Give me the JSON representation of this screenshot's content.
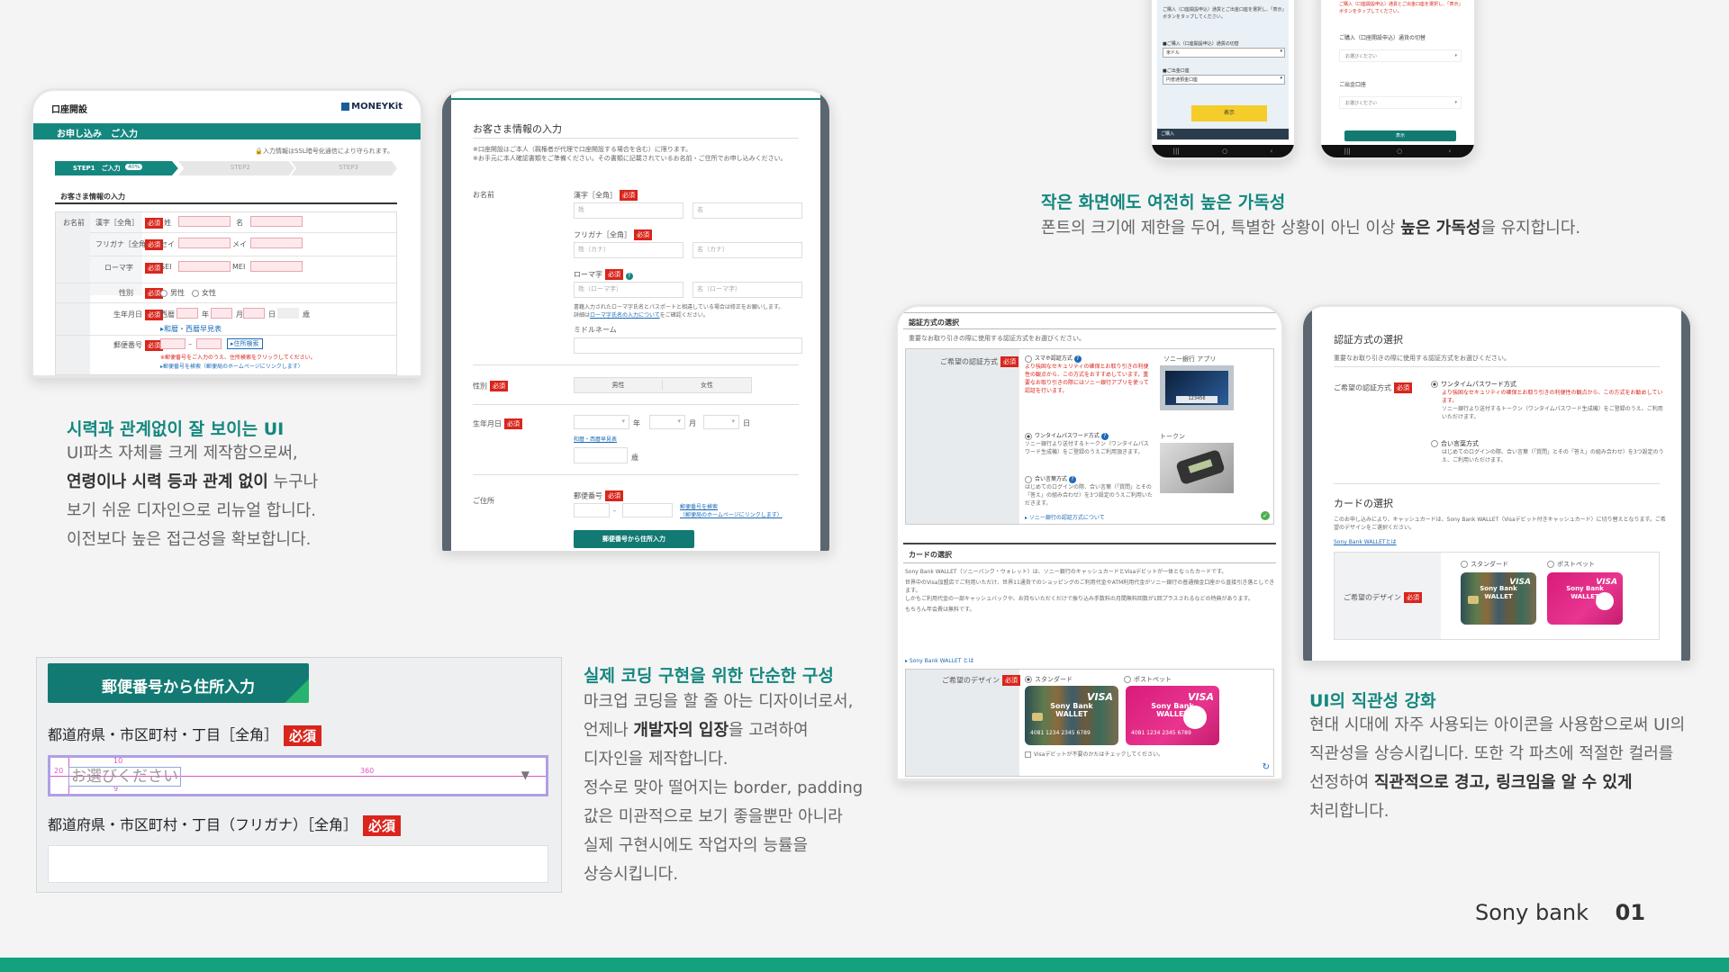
{
  "form_shot": {
    "title": "口座開設",
    "logo": "MONEYKit",
    "banner": "お申し込み　ご入力",
    "ssl_note": "入力情報はSSL暗号化通信により守られます。",
    "steps": [
      "STEP1　ご入力",
      "STEP2",
      "STEP3"
    ],
    "step1_badge": "40%",
    "section": "お客さま情報の入力",
    "name_label": "お名前",
    "kanji_label": "漢字［全角］",
    "kana_label": "フリガナ［全角］",
    "roma_label": "ローマ字",
    "sei": "姓",
    "mei": "名",
    "sei_kana": "セイ",
    "mei_kana": "メイ",
    "sei_roma": "SEI",
    "mei_roma": "MEI",
    "gender_label": "性別",
    "male": "男性",
    "female": "女性",
    "birth_label": "生年月日",
    "era": "西暦",
    "year": "年",
    "month": "月",
    "day": "日",
    "age": "歳",
    "calendar_link": "和暦・西暦早見表",
    "postal_label": "郵便番号",
    "postal_btn": "住所検索",
    "postal_note1": "※郵便番号をご入力のうえ、住所検索をクリックしてください。",
    "postal_note2": "郵便番号を検索（郵便局のホームページにリンクします）",
    "required": "必須"
  },
  "detail_shot": {
    "title": "お客さま情報の入力",
    "note1": "※口座開設はご本人（親権者が代理で口座開設する場合を含む）に限ります。",
    "note2": "※お手元に本人確認書類をご準備ください。その書類に記載されているお名前・ご住所でお申し込みください。",
    "name_label": "お名前",
    "kanji_label": "漢字［全角］",
    "sei": "姓",
    "mei": "名",
    "kana_label": "フリガナ［全角］",
    "sei_kana": "姓（カナ）",
    "mei_kana": "名（カナ）",
    "roma_label": "ローマ字",
    "sei_roma": "姓（ローマ字）",
    "mei_roma": "名（ローマ字）",
    "roma_note1": "書籍入力されたローマ字氏名とパスポートと相違している場合は修正をお願いします。",
    "roma_note2": "詳細は",
    "roma_link": "ローマ字氏名の入力について",
    "roma_note3": "をご確認ください。",
    "middle_label": "ミドルネーム",
    "gender_label": "性別",
    "male": "男性",
    "female": "女性",
    "birth_label": "生年月日",
    "year": "年",
    "month": "月",
    "day": "日",
    "calendar_link": "和暦・西暦早見表",
    "age": "歳",
    "address_label": "ご住所",
    "postal_label": "郵便番号",
    "postal_link1": "郵便番号を検索",
    "postal_link2": "（郵便局のホームページにリンクします）",
    "postal_btn": "郵便番号から住所入力",
    "required": "必須"
  },
  "phone_a": {
    "text1": "ご購入（口座開設申込）通貨とご出金口座を選択し、「表示」ボタンをタップしてください。",
    "label1": "■ご購入（口座開設申込）通貨の切替",
    "value1": "米ドル",
    "label2": "■ご出金口座",
    "value2": "円普通預金口座",
    "button": "表示",
    "bottom": "ご購入"
  },
  "phone_b": {
    "text1": "ご購入（口座開設申込）通貨とご出金口座を選択し、「表示」ボタンをタップしてください。",
    "label1": "ご購入（口座開設申込）通貨の切替",
    "value1": "お選びください",
    "label2": "ご出金口座",
    "value2": "お選びください",
    "button": "表示"
  },
  "mobile_section": {
    "heading": "작은 화면에도 여전히 높은 가독성",
    "body_pre": "폰트의 크기에 제한을 두어, 특별한 상황이 아닌 이상 ",
    "body_bold": "높은 가독성",
    "body_post": "을 유지합니다."
  },
  "auth_old": {
    "title": "認証方式の選択",
    "desc": "重要なお取り引きの際に使用する認証方式をお選びください。",
    "label": "ご希望の認証方式",
    "app_header": "ソニー銀行 アプリ",
    "opt1": "スマホ認証方式",
    "opt1_desc": "より強固なセキュリティの確保とお取り引きの利便性の観点から、この方式をおすすめしています。重要なお取り引きの際にはソニー銀行アプリを使って認証を行います。",
    "opt2": "ワンタイムパスワード方式",
    "opt2_desc": "ソニー銀行より送付するトークン（ワンタイムパスワード生成機）をご登録のうえご利用頂きます。",
    "token_header": "トークン",
    "opt3": "合い言葉方式",
    "opt3_desc": "はじめてのログインの際、合い言葉（「質問」とその「答え」の組み合わせ）を3つ設定のうえご利用いただきます。",
    "link": "ソニー銀行の認証方式について",
    "app_code": "123456",
    "card_title": "カードの選択",
    "card_desc1": "Sony Bank WALLET（ソニーバンク・ウォレット）は、ソニー銀行のキャッシュカードとVisaデビットが一体となったカードです。",
    "card_desc2": "世界中のVisa加盟店でご利用いただけ、世界11通貨でのショッピングのご利用代金やATM利用代金がソニー銀行の普通預金口座から直接引き落としできます。",
    "card_desc3": "しかもご利用代金の一部キャッシュバックや、お持ちいただくだけで振り込み手数料の月間無料回数が1回プラスされるなどの特典があります。",
    "card_desc4": "もちろん年会費は無料です。",
    "card_link": "Sony Bank WALLET とは",
    "design_label": "ご希望のデザイン",
    "std": "スタンダード",
    "pet": "ポストペット",
    "no_visa": "Visaデビットが不要のかたはチェックしてください。",
    "required": "必須"
  },
  "auth_new": {
    "title": "認証方式の選択",
    "desc": "重要なお取り引きの際に使用する認証方式をお選びください。",
    "label": "ご希望の認証方式",
    "opt1": "ワンタイムパスワード方式",
    "opt1_desc1": "より強固なセキュリティの確保とお取り引きの利便性の観点から、この方式をお勧めしています。",
    "opt1_desc2": "ソニー銀行より送付するトークン（ワンタイムパスワード生成機）をご登録のうえ、ご利用いただけます。",
    "opt2": "合い言葉方式",
    "opt2_desc": "はじめてのログインの際、合い言葉（「質問」とその「答え」の組み合わせ）を3つ設定のうえ、ご利用いただけます。",
    "card_title": "カードの選択",
    "card_desc": "このお申し込みにより、キャッシュカードは、Sony Bank WALLET（Visaデビット付きキャッシュカード）に切り替えとなります。ご希望のデザインをご選択ください。",
    "card_link": "Sony Bank WALLETとは",
    "design_label": "ご希望のデザイン",
    "std": "スタンダード",
    "pet": "ポストペット",
    "required": "必須"
  },
  "card_text": {
    "brand": "Sony Bank",
    "wallet": "WALLET",
    "visa": "VISA",
    "number": "4081 1234 2345 6789"
  },
  "visibility_section": {
    "heading": "시력과 관계없이 잘 보이는 UI",
    "line1": "UI파츠 자체를 크게 제작함으로써,",
    "line2_bold": "연령이나 시력 등과 관계 없이",
    "line2_post": " 누구나",
    "line3": "보기 쉬운 디자인으로 리뉴얼 합니다.",
    "line4": "이전보다 높은 접근성을 확보합니다."
  },
  "zoom_shot": {
    "button": "郵便番号から住所入力",
    "label1": "都道府県・市区町村・丁目［全角］",
    "placeholder": "お選びください",
    "label2": "都道府県・市区町村・丁目（フリガナ）［全角］",
    "required": "必須",
    "m_top": "10",
    "m_left": "20",
    "m_width": "360",
    "m_bottom": "9"
  },
  "coding_section": {
    "heading": "실제 코딩 구현을 위한 단순한 구성",
    "line1": "마크업 코딩을 할 줄 아는 디자이너로서,",
    "line2_pre": "언제나 ",
    "line2_bold": "개발자의 입장",
    "line2_post": "을 고려하여",
    "line3": "디자인을 제작합니다.",
    "line4": "정수로 맞아 떨어지는 border, padding",
    "line5": "값은 미관적으로 보기 좋을뿐만 아니라",
    "line6": "실제 구현시에도 작업자의 능률을",
    "line7": "상승시킵니다."
  },
  "intuitive_section": {
    "heading": "UI의 직관성 강화",
    "line1": "현대 시대에 자주 사용되는 아이콘을 사용함으로써 UI의",
    "line2": "직관성을 상승시킵니다. 또한 각 파츠에 적절한 컬러를",
    "line3_pre": "선정하여 ",
    "line3_bold": "직관적으로 경고, 링크임을 알 수 있게",
    "line4": "처리합니다."
  },
  "footer": {
    "brand": "Sony bank",
    "page": "01"
  },
  "colors": {
    "accent": "#14877f",
    "required": "#d9251c",
    "bar": "#12a27e"
  }
}
